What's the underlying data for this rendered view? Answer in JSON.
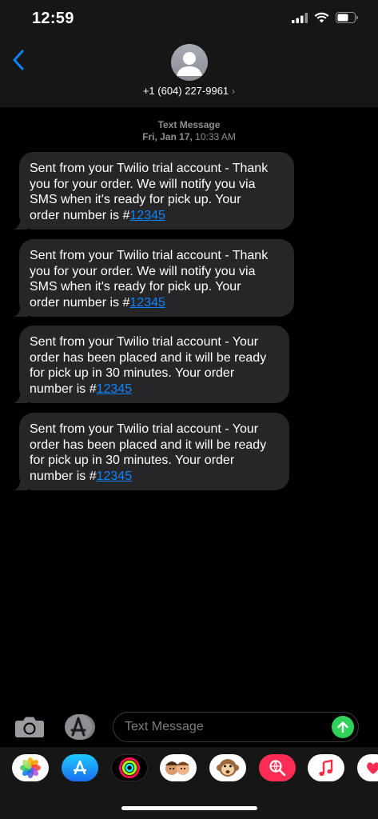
{
  "status_bar": {
    "time": "12:59"
  },
  "header": {
    "contact": "+1 (604) 227-9961",
    "chevron": "›"
  },
  "thread": {
    "service": "Text Message",
    "date": "Fri, Jan 17,",
    "time": "10:33 AM"
  },
  "messages": [
    {
      "lines": [
        "Sent from your Twilio trial account - Thank",
        "you for your order. We will notify you via",
        "SMS when it's ready for pick up. Your"
      ],
      "last_prefix": "order number is #",
      "link": "12345"
    },
    {
      "lines": [
        "Sent from your Twilio trial account - Thank",
        "you for your order. We will notify you via",
        "SMS when it's ready for pick up. Your"
      ],
      "last_prefix": "order number is #",
      "link": "12345"
    },
    {
      "lines": [
        "Sent from your Twilio trial account - Your",
        "order has been placed and it will be ready",
        "for pick up in 30 minutes. Your order"
      ],
      "last_prefix": "number is #",
      "link": "12345"
    },
    {
      "lines": [
        "Sent from your Twilio trial account - Your",
        "order has been placed and it will be ready",
        "for pick up in 30 minutes. Your order"
      ],
      "last_prefix": "number is #",
      "link": "12345"
    }
  ],
  "composer": {
    "placeholder": "Text Message"
  },
  "app_drawer": {
    "apps": [
      "photos-icon",
      "app-store-icon",
      "activity-icon",
      "memoji-icon",
      "animoji-monkey-icon",
      "web-images-search-icon",
      "music-icon",
      "digital-touch-icon"
    ]
  },
  "colors": {
    "background": "#000000",
    "header_bg": "#161616",
    "bubble_bg": "#262628",
    "link": "#0a84ff",
    "send": "#30d158",
    "back_arrow": "#0a84ff"
  }
}
